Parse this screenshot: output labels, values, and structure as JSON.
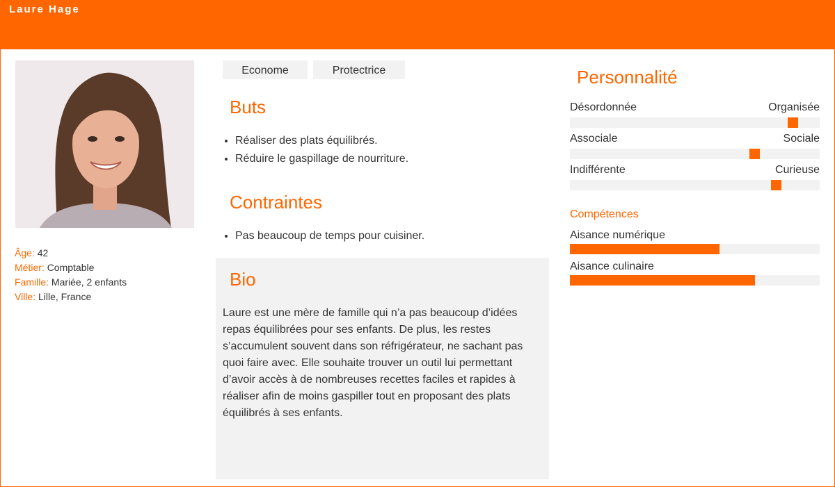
{
  "persona": {
    "name": "Laure Hage"
  },
  "info": {
    "age": {
      "label": "Âge:",
      "value": "42"
    },
    "job": {
      "label": "Métier:",
      "value": "Comptable"
    },
    "family": {
      "label": "Famille:",
      "value": "Mariée, 2 enfants"
    },
    "city": {
      "label": "Ville:",
      "value": "Lille, France"
    }
  },
  "tags": [
    "Econome",
    "Protectrice"
  ],
  "goals": {
    "title": "Buts",
    "items": [
      "Réaliser des plats équilibrés.",
      "Réduire le gaspillage de nourriture."
    ]
  },
  "constraints": {
    "title": "Contraintes",
    "items": [
      "Pas beaucoup de temps pour cuisiner."
    ]
  },
  "bio": {
    "title": "Bio",
    "text": "Laure est une mère de famille qui n’a pas beaucoup d’idées repas équilibrées pour ses enfants. De plus, les restes s’accumulent souvent dans son réfrigérateur, ne sachant pas quoi faire avec. Elle souhaite trouver un outil lui permettant d’avoir accès à de nombreuses recettes faciles et rapides à réaliser afin de moins gaspiller tout en proposant des plats équilibrés à ses enfants."
  },
  "personality": {
    "title": "Personnalité",
    "traits": [
      {
        "left": "Désordonnée",
        "right": "Organisée",
        "level": 0.91
      },
      {
        "left": "Associale",
        "right": "Sociale",
        "level": 0.75
      },
      {
        "left": "Indifférente",
        "right": "Curieuse",
        "level": 0.84
      }
    ]
  },
  "skills": {
    "title": "Compétences",
    "items": [
      {
        "label": "Aisance numérique",
        "level": 0.6
      },
      {
        "label": "Aisance culinaire",
        "level": 0.74
      }
    ]
  },
  "colors": {
    "accent": "#ff6600",
    "panel": "#f2f2f2"
  }
}
